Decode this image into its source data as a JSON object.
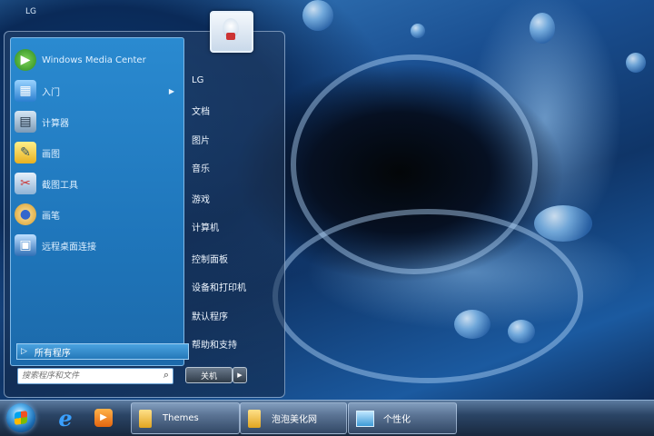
{
  "desktop": {
    "label": "LG"
  },
  "start_menu": {
    "programs": [
      {
        "label": "Windows Media Center",
        "icon": "media-center-icon",
        "has_submenu": false
      },
      {
        "label": "入门",
        "icon": "getting-started-icon",
        "has_submenu": true
      },
      {
        "label": "计算器",
        "icon": "calculator-icon",
        "has_submenu": false
      },
      {
        "label": "画图",
        "icon": "paint-icon",
        "has_submenu": false
      },
      {
        "label": "截图工具",
        "icon": "snipping-tool-icon",
        "has_submenu": false
      },
      {
        "label": "画笔",
        "icon": "brush-icon",
        "has_submenu": false
      },
      {
        "label": "远程桌面连接",
        "icon": "remote-desktop-icon",
        "has_submenu": false
      }
    ],
    "all_programs": "所有程序",
    "search_placeholder": "搜索程序和文件",
    "right_items": [
      "LG",
      "文档",
      "图片",
      "音乐",
      "游戏",
      "计算机",
      "控制面板",
      "设备和打印机",
      "默认程序",
      "帮助和支持"
    ],
    "shutdown_label": "关机"
  },
  "taskbar": {
    "buttons": [
      {
        "label": "Themes",
        "icon": "folder-icon"
      },
      {
        "label": "泡泡美化网",
        "icon": "folder-icon"
      },
      {
        "label": "个性化",
        "icon": "control-panel-icon"
      }
    ]
  },
  "colors": {
    "menu_blue": "#1f76bb",
    "taskbar_dark": "#18283e"
  }
}
